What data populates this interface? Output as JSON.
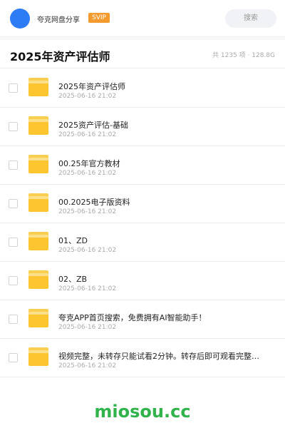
{
  "topbar": {
    "username": "夸克网盘分享",
    "badge": "SVIP",
    "search_placeholder": "搜索"
  },
  "header": {
    "title": "2025年资产评估师",
    "stats": "共 1235 项 · 128.8G"
  },
  "files": [
    {
      "name": "2025年资产评估师",
      "date": "2025-06-16 21:02"
    },
    {
      "name": "2025资产评估-基础",
      "date": "2025-06-16 21:02"
    },
    {
      "name": "00.25年官方教材",
      "date": "2025-06-16 21:02"
    },
    {
      "name": "00.2025电子版资料",
      "date": "2025-06-16 21:02"
    },
    {
      "name": "01、ZD",
      "date": "2025-06-16 21:02"
    },
    {
      "name": "02、ZB",
      "date": "2025-06-16 21:02"
    },
    {
      "name": "夸克APP首页搜索，免费拥有AI智能助手！",
      "date": "2025-06-16 21:02"
    },
    {
      "name": "视频完整，未转存只能试看2分钟。转存后即可观看完整…",
      "date": "2025-06-16 21:02"
    }
  ],
  "watermark": "miosou.cc",
  "colors": {
    "avatar": "#2d7cf6",
    "badge": "#f39b2f",
    "folder": "#fdc52f",
    "watermark": "#2fb34a"
  }
}
